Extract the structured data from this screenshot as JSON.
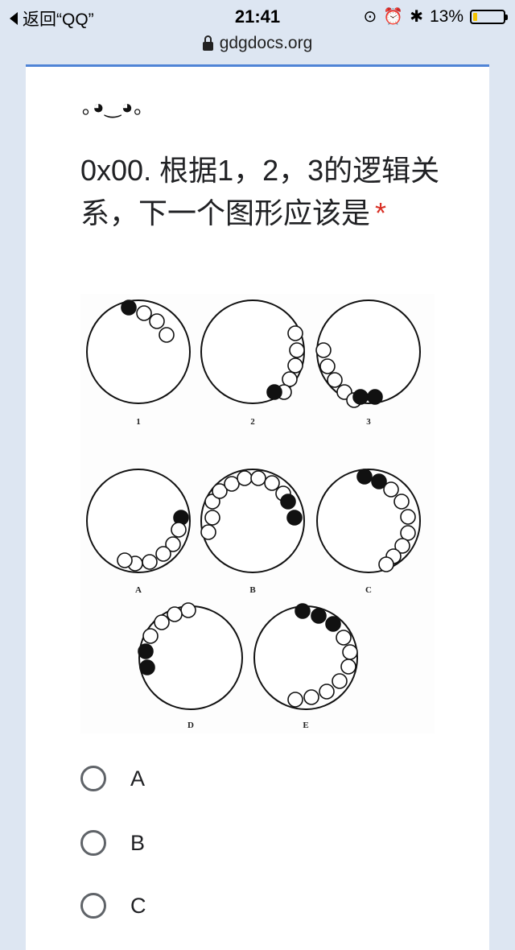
{
  "status_bar": {
    "back_label": "返回“QQ”",
    "time": "21:41",
    "icons": [
      "rotation-lock-icon",
      "alarm-icon",
      "bluetooth-icon"
    ],
    "battery_percent_label": "13%",
    "battery_level": 0.13,
    "battery_color": "#f5c400"
  },
  "url_bar": {
    "domain": "gdgdocs.org"
  },
  "form": {
    "accent_color": "#4f84d6",
    "kaomoji": "｡◕‿◕｡",
    "question_text": "0x00. 根据1，2，3的逻辑关系，下一个图形应该是",
    "required_mark": "*",
    "figure_labels": [
      "1",
      "2",
      "3",
      "A",
      "B",
      "C",
      "D",
      "E"
    ],
    "options": [
      {
        "label": "A",
        "selected": false
      },
      {
        "label": "B",
        "selected": false
      },
      {
        "label": "C",
        "selected": false
      }
    ]
  }
}
